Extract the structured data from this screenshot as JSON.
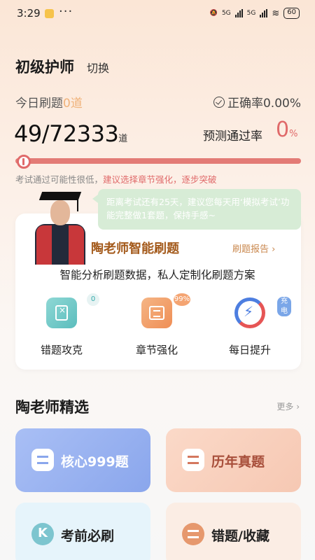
{
  "status_bar": {
    "time": "3:29",
    "dots": "···",
    "network_1": "5G",
    "network_2": "5G",
    "battery": "60"
  },
  "header": {
    "title": "初级护师",
    "switch_label": "切换"
  },
  "stats": {
    "today_label": "今日刷题",
    "today_count": "0道",
    "accuracy": "正确率0.00%",
    "progress_count": "49/72333",
    "progress_unit": "道",
    "pass_rate_label": "预测通过率",
    "pass_rate_value": "0",
    "pass_rate_unit": "%",
    "progress_fraction": 0.0007,
    "hint_prefix": "考试通过可能性很低，",
    "hint_suggest": "建议选择章节强化，逐步突破"
  },
  "teacher_card": {
    "bubble_text": "距离考试还有25天，建议您每天用‘模拟考试’功能完整做1套题，保持手感~",
    "title": "陶老师智能刷题",
    "report_link": "刷题报告 ›",
    "subtitle": "智能分析刷题数据，私人定制化刷题方案",
    "features": [
      {
        "label": "错题攻克",
        "badge": "0",
        "icon": "wrong-questions-icon"
      },
      {
        "label": "章节强化",
        "badge": "99%",
        "icon": "chapter-icon"
      },
      {
        "label": "每日提升",
        "badge": "充电",
        "icon": "daily-bolt-icon"
      }
    ]
  },
  "selection": {
    "title": "陶老师精选",
    "more": "更多 ›",
    "tiles": [
      {
        "label": "核心999题"
      },
      {
        "label": "历年真题"
      },
      {
        "label": "考前必刷"
      },
      {
        "label": "错题/收藏"
      }
    ]
  },
  "colors": {
    "accent_red": "#e06a6a",
    "brown_title": "#a3591a",
    "bubble_green": "#d7ecd6"
  }
}
